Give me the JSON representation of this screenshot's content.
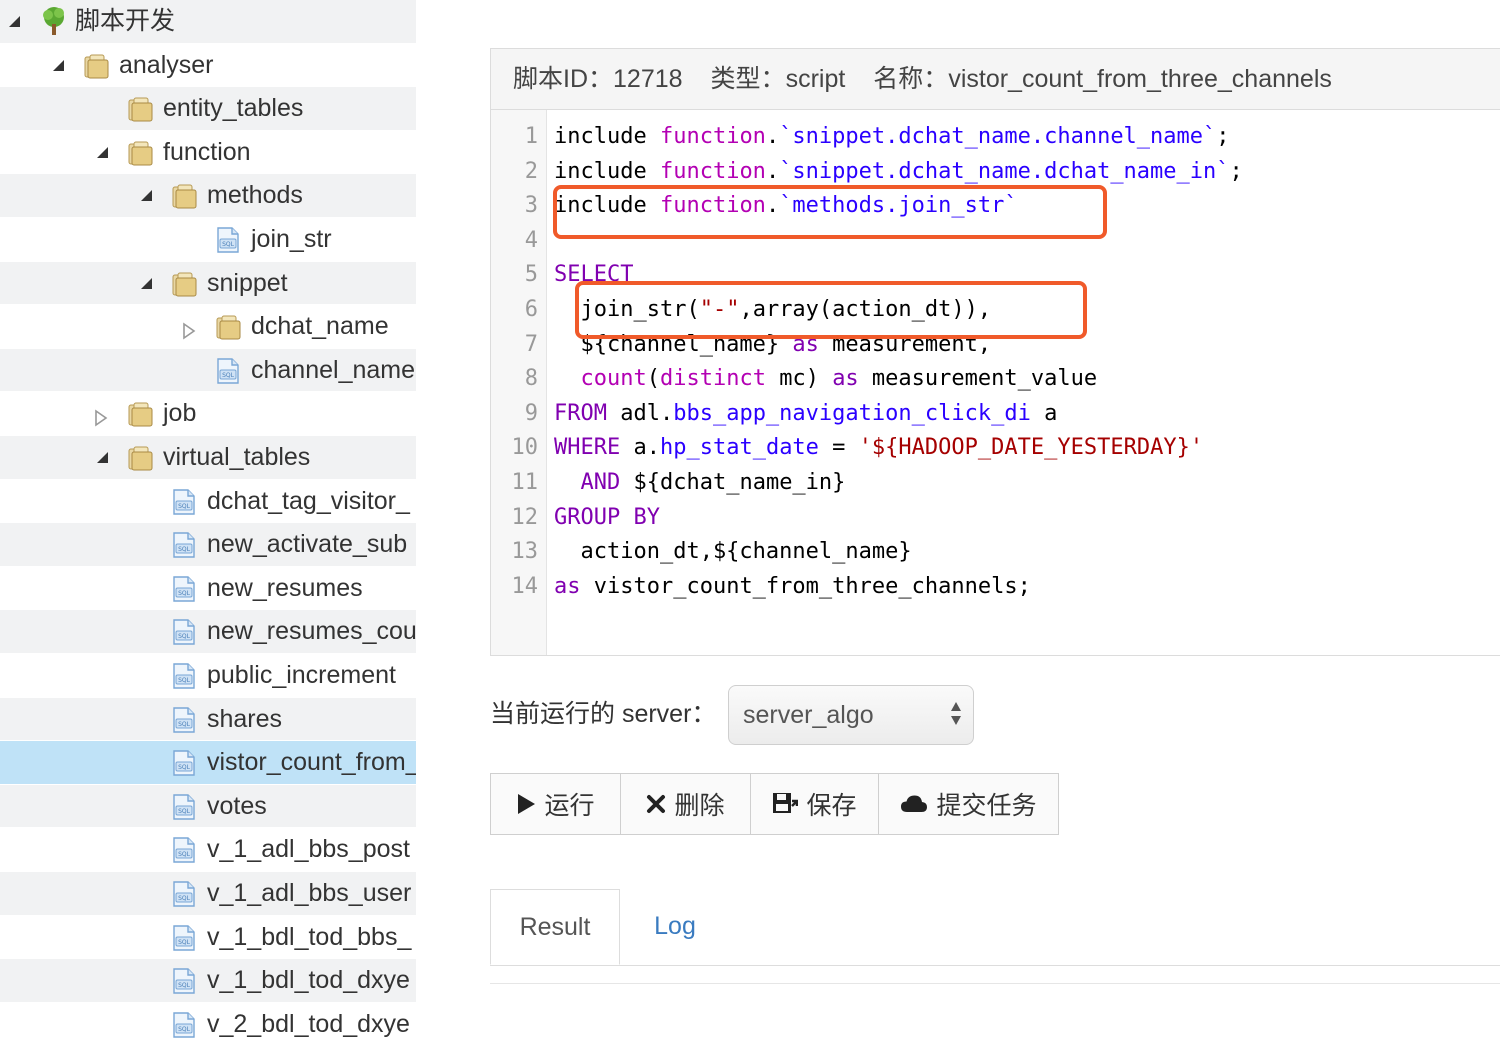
{
  "tree": [
    {
      "label": "脚本开发",
      "type": "root",
      "toggle": "open",
      "depth": 0,
      "striped": true
    },
    {
      "label": "analyser",
      "type": "folder",
      "toggle": "open",
      "depth": 1,
      "striped": false
    },
    {
      "label": "entity_tables",
      "type": "folder",
      "toggle": "none",
      "depth": 2,
      "striped": true,
      "hovered": true
    },
    {
      "label": "function",
      "type": "folder",
      "toggle": "open",
      "depth": 2,
      "striped": false
    },
    {
      "label": "methods",
      "type": "folder",
      "toggle": "open",
      "depth": 3,
      "striped": true
    },
    {
      "label": "join_str",
      "type": "sql",
      "toggle": "none",
      "depth": 4,
      "striped": false
    },
    {
      "label": "snippet",
      "type": "folder",
      "toggle": "open",
      "depth": 3,
      "striped": true
    },
    {
      "label": "dchat_name",
      "type": "folder",
      "toggle": "closed",
      "depth": 4,
      "striped": false
    },
    {
      "label": "channel_name",
      "type": "sql",
      "toggle": "none",
      "depth": 4,
      "striped": true
    },
    {
      "label": "job",
      "type": "folder",
      "toggle": "closed",
      "depth": 2,
      "striped": false
    },
    {
      "label": "virtual_tables",
      "type": "folder",
      "toggle": "open",
      "depth": 2,
      "striped": true
    },
    {
      "label": "dchat_tag_visitor_",
      "type": "sql",
      "toggle": "none",
      "depth": 3,
      "striped": false
    },
    {
      "label": "new_activate_sub",
      "type": "sql",
      "toggle": "none",
      "depth": 3,
      "striped": true
    },
    {
      "label": "new_resumes",
      "type": "sql",
      "toggle": "none",
      "depth": 3,
      "striped": false
    },
    {
      "label": "new_resumes_cou",
      "type": "sql",
      "toggle": "none",
      "depth": 3,
      "striped": true
    },
    {
      "label": "public_increment",
      "type": "sql",
      "toggle": "none",
      "depth": 3,
      "striped": false
    },
    {
      "label": "shares",
      "type": "sql",
      "toggle": "none",
      "depth": 3,
      "striped": true
    },
    {
      "label": "vistor_count_from_",
      "type": "sql",
      "toggle": "none",
      "depth": 3,
      "striped": false,
      "selected": true
    },
    {
      "label": "votes",
      "type": "sql",
      "toggle": "none",
      "depth": 3,
      "striped": true
    },
    {
      "label": "v_1_adl_bbs_post",
      "type": "sql",
      "toggle": "none",
      "depth": 3,
      "striped": false
    },
    {
      "label": "v_1_adl_bbs_user",
      "type": "sql",
      "toggle": "none",
      "depth": 3,
      "striped": true
    },
    {
      "label": "v_1_bdl_tod_bbs_",
      "type": "sql",
      "toggle": "none",
      "depth": 3,
      "striped": false
    },
    {
      "label": "v_1_bdl_tod_dxye",
      "type": "sql",
      "toggle": "none",
      "depth": 3,
      "striped": true
    },
    {
      "label": "v_2_bdl_tod_dxye",
      "type": "sql",
      "toggle": "none",
      "depth": 3,
      "striped": false
    }
  ],
  "header": {
    "id_label": "脚本ID：",
    "id_value": "12718",
    "type_label": "类型：",
    "type_value": "script",
    "name_label": "名称：",
    "name_value": "vistor_count_from_three_channels"
  },
  "editor": {
    "lines": [
      [
        [
          "include ",
          "var"
        ],
        [
          "function",
          "fn"
        ],
        [
          ".",
          "var"
        ],
        [
          "`snippet.dchat_name.channel_name`",
          "str"
        ],
        [
          ";",
          "var"
        ]
      ],
      [
        [
          "include ",
          "var"
        ],
        [
          "function",
          "fn"
        ],
        [
          ".",
          "var"
        ],
        [
          "`snippet.dchat_name.dchat_name_in`",
          "str"
        ],
        [
          ";",
          "var"
        ]
      ],
      [
        [
          "include ",
          "var"
        ],
        [
          "function",
          "fn"
        ],
        [
          ".",
          "var"
        ],
        [
          "`methods.join_str`",
          "str"
        ]
      ],
      [],
      [
        [
          "SELECT",
          "kw"
        ]
      ],
      [
        [
          "  join_str(",
          "var"
        ],
        [
          "\"-\"",
          "str2"
        ],
        [
          ",array(action_dt)),",
          "var"
        ]
      ],
      [
        [
          "  ${channel_name} ",
          "var"
        ],
        [
          "as",
          "kw"
        ],
        [
          " measurement,",
          "var"
        ]
      ],
      [
        [
          "  ",
          "var"
        ],
        [
          "count",
          "fn"
        ],
        [
          "(",
          "var"
        ],
        [
          "distinct",
          "fn"
        ],
        [
          " mc) ",
          "var"
        ],
        [
          "as",
          "kw"
        ],
        [
          " measurement_value",
          "var"
        ]
      ],
      [
        [
          "FROM",
          "kw"
        ],
        [
          " adl.",
          "var"
        ],
        [
          "bbs_app_navigation_click_di",
          "str"
        ],
        [
          " a",
          "var"
        ]
      ],
      [
        [
          "WHERE",
          "kw"
        ],
        [
          " a.",
          "var"
        ],
        [
          "hp_stat_date",
          "str"
        ],
        [
          " = ",
          "var"
        ],
        [
          "'${HADOOP_DATE_YESTERDAY}'",
          "str2"
        ]
      ],
      [
        [
          "  ",
          "var"
        ],
        [
          "AND",
          "kw"
        ],
        [
          " ${dchat_name_in}",
          "var"
        ]
      ],
      [
        [
          "GROUP BY",
          "kw"
        ]
      ],
      [
        [
          "  action_dt,${channel_name}",
          "var"
        ]
      ],
      [
        [
          "as",
          "kw"
        ],
        [
          " vistor_count_from_three_channels;",
          "var"
        ]
      ]
    ]
  },
  "server": {
    "label": "当前运行的 server：",
    "selected": "server_algo"
  },
  "toolbar": {
    "run": {
      "label": "运行",
      "icon": "play-icon"
    },
    "delete": {
      "label": "删除",
      "icon": "close-icon"
    },
    "save": {
      "label": "保存",
      "icon": "save-icon"
    },
    "submit": {
      "label": "提交任务",
      "icon": "cloud-icon"
    }
  },
  "tabs": {
    "result": "Result",
    "log": "Log"
  },
  "colors": {
    "highlight_box": "#f05a2a",
    "selected_row": "#bfe2f7",
    "link": "#3a7bc0"
  }
}
